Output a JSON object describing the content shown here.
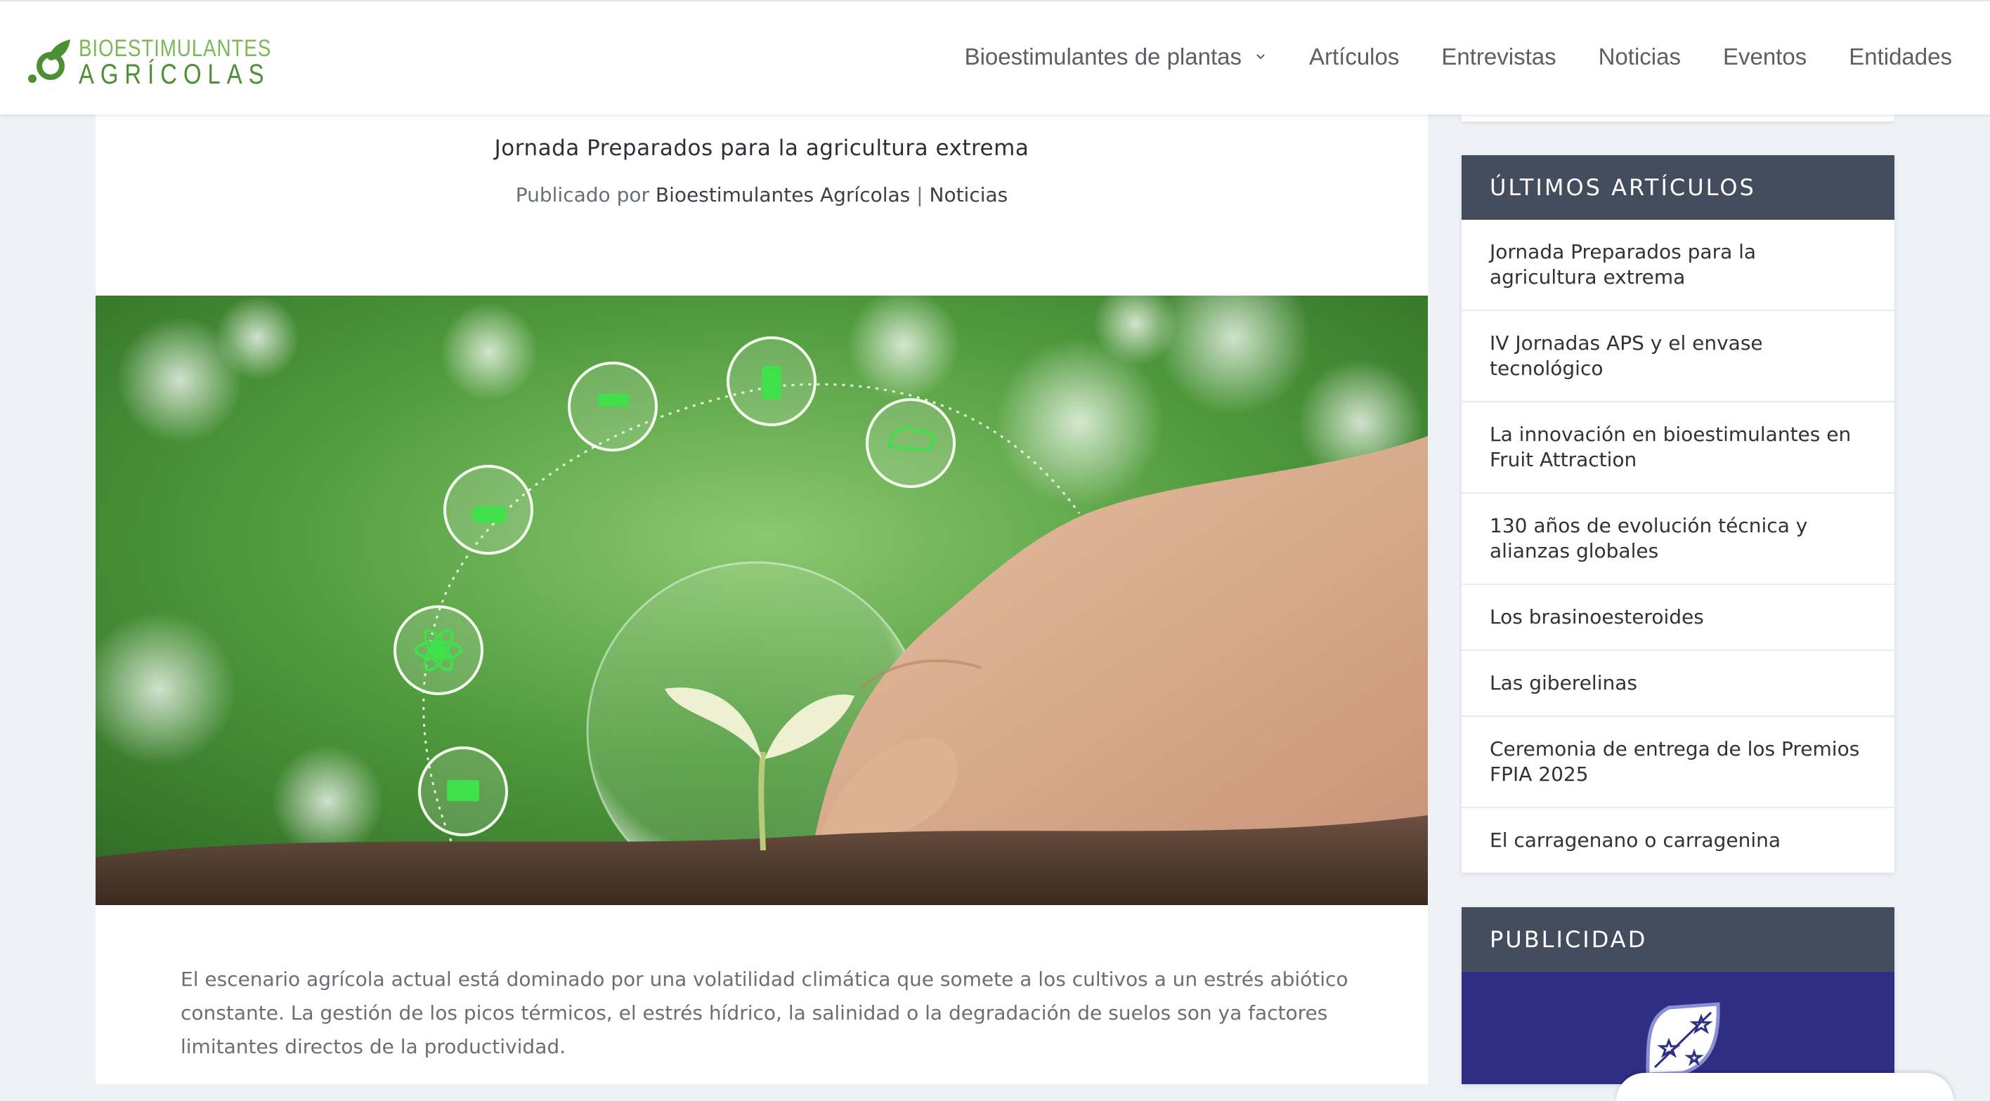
{
  "site": {
    "logo_line1": "BIOESTIMULANTES",
    "logo_line2": "AGRÍCOLAS",
    "brand_color": "#4d8f33"
  },
  "nav": {
    "items": [
      {
        "label": "Bioestimulantes de plantas",
        "has_dropdown": true
      },
      {
        "label": "Artículos"
      },
      {
        "label": "Entrevistas"
      },
      {
        "label": "Noticias"
      },
      {
        "label": "Eventos"
      },
      {
        "label": "Entidades"
      }
    ]
  },
  "post": {
    "title": "Jornada Preparados para la agricultura extrema",
    "meta_prefix": "Publicado por",
    "author": "Bioestimulantes Agrícolas",
    "separator": "|",
    "category": "Noticias",
    "body": "El escenario agrícola actual está dominado por una volatilidad climática que somete a los cultivos a un estrés abiótico constante. La gestión de los picos térmicos, el estrés hídrico, la salinidad o la degradación de suelos son ya factores limitantes directos de la productividad."
  },
  "sidebar": {
    "latest_title": "ÚLTIMOS ARTÍCULOS",
    "latest": [
      "Jornada Preparados para la agricultura extrema",
      "IV Jornadas APS y el envase tecnológico",
      "La innovación en bioestimulantes en Fruit Attraction",
      "130 años de evolución técnica y alianzas globales",
      "Los brasinoesteroides",
      "Las giberelinas",
      "Ceremonia de entrega de los Premios FPIA 2025",
      "El carragenano o carragenina"
    ],
    "ad_title": "PUBLICIDAD",
    "header_color": "#434d5e",
    "ad_color": "#2e2e85"
  }
}
